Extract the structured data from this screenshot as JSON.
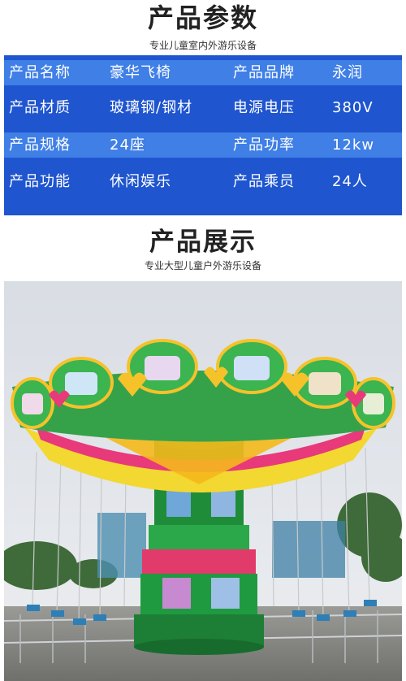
{
  "section1": {
    "title": "产品参数",
    "subtitle": "专业儿童室内外游乐设备"
  },
  "params": [
    {
      "label1": "产品名称",
      "value1": "豪华飞椅",
      "label2": "产品品牌",
      "value2": "永润"
    },
    {
      "label1": "产品材质",
      "value1": "玻璃钢/钢材",
      "label2": "电源电压",
      "value2": "380V"
    },
    {
      "label1": "产品规格",
      "value1": "24座",
      "label2": "产品功率",
      "value2": "12kw"
    },
    {
      "label1": "产品功能",
      "value1": "休闲娱乐",
      "label2": "产品乘员",
      "value2": "24人"
    }
  ],
  "section2": {
    "title": "产品展示",
    "subtitle": "专业大型儿童户外游乐设备"
  },
  "colors": {
    "table_bg": "#1f55cf",
    "row_light": "#3f7fe6",
    "text": "#ffffff"
  },
  "photo": {
    "icon": "swing-ride-photo"
  }
}
